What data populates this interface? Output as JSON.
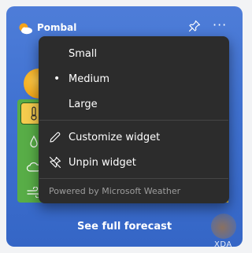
{
  "widget": {
    "location": "Pombal",
    "brand_icon": "weather-icon",
    "pin_icon": "pin-icon",
    "more_icon": "more-options-icon",
    "more_label": "···",
    "forecast_link": "See full forecast",
    "metrics": [
      "thermometer-icon",
      "droplet-icon",
      "cloud-icon",
      "wind-icon"
    ]
  },
  "menu": {
    "size_options": [
      {
        "label": "Small",
        "selected": false
      },
      {
        "label": "Medium",
        "selected": true
      },
      {
        "label": "Large",
        "selected": false
      }
    ],
    "bullet": "•",
    "customize_label": "Customize widget",
    "customize_icon": "edit-pencil-icon",
    "unpin_label": "Unpin widget",
    "unpin_icon": "unpin-icon",
    "powered_by": "Powered by Microsoft Weather"
  },
  "watermark": "XDA",
  "colors": {
    "card_blue": "#3f71d1",
    "menu_bg": "#2c2c2c",
    "accent_yellow": "#f6cc4e",
    "panel_green": "#58ad47"
  }
}
